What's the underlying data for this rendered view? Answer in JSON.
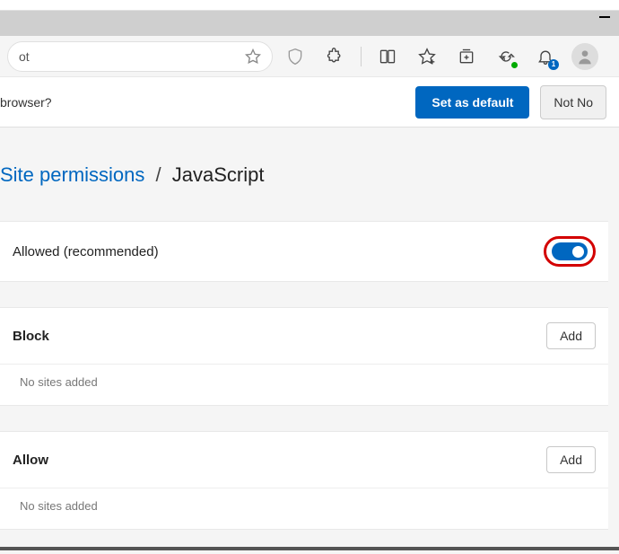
{
  "address_fragment": "ot",
  "banner": {
    "question": "browser?",
    "set_default": "Set as default",
    "not_now": "Not No"
  },
  "breadcrumb": {
    "parent": "Site permissions",
    "sep": "/",
    "current": "JavaScript"
  },
  "allowed": {
    "label": "Allowed (recommended)",
    "toggle_on": true
  },
  "block": {
    "title": "Block",
    "add": "Add",
    "empty": "No sites added"
  },
  "allow": {
    "title": "Allow",
    "add": "Add",
    "empty": "No sites added"
  },
  "notif_count": "1"
}
